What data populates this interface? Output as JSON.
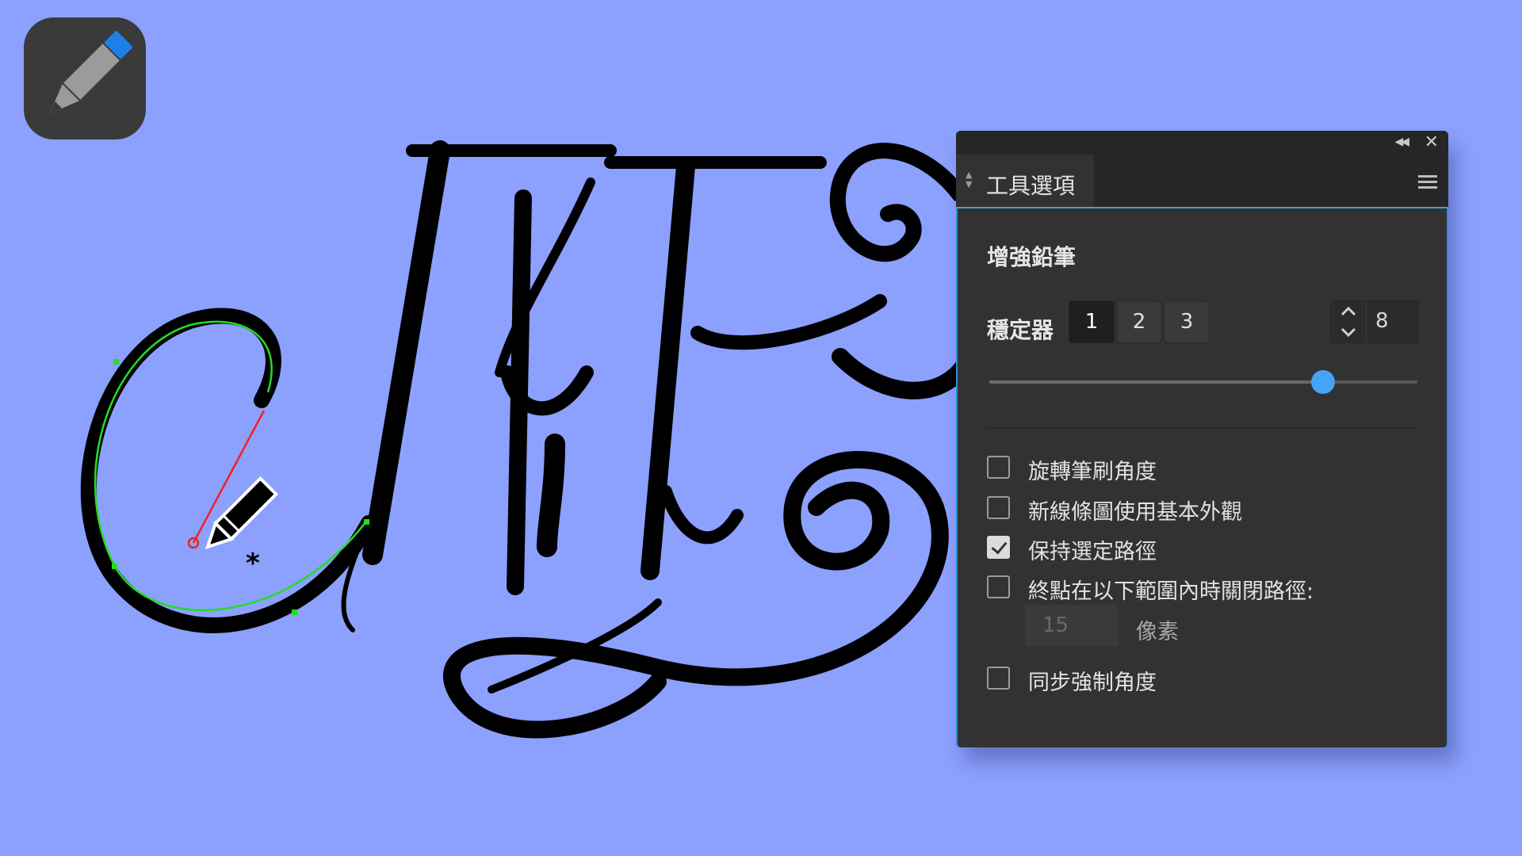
{
  "app_icon": {
    "name": "pencil-icon",
    "colors": {
      "tile": "#3a3a3a",
      "body": "#9b9b9b",
      "eraser": "#1e7fe8"
    }
  },
  "artwork": {
    "description_colors": {
      "ink": "#000000",
      "path": "#22dd22",
      "handle": "#ee2222",
      "background": "#8ca0fe"
    }
  },
  "panel": {
    "tab_label": "工具選項",
    "tool_title": "增強鉛筆",
    "stabilizer": {
      "label": "穩定器",
      "modes": [
        "1",
        "2",
        "3"
      ],
      "active_mode": "1",
      "value": "8",
      "slider_fraction": 0.78
    },
    "options": [
      {
        "label": "旋轉筆刷角度",
        "checked": false
      },
      {
        "label": "新線條圖使用基本外觀",
        "checked": false
      },
      {
        "label": "保持選定路徑",
        "checked": true
      },
      {
        "label": "終點在以下範圍內時關閉路徑:",
        "checked": false
      },
      {
        "label": "同步強制角度",
        "checked": false
      }
    ],
    "close_distance": {
      "value": "15",
      "unit": "像素"
    }
  },
  "accent_color": "#46a3f5"
}
